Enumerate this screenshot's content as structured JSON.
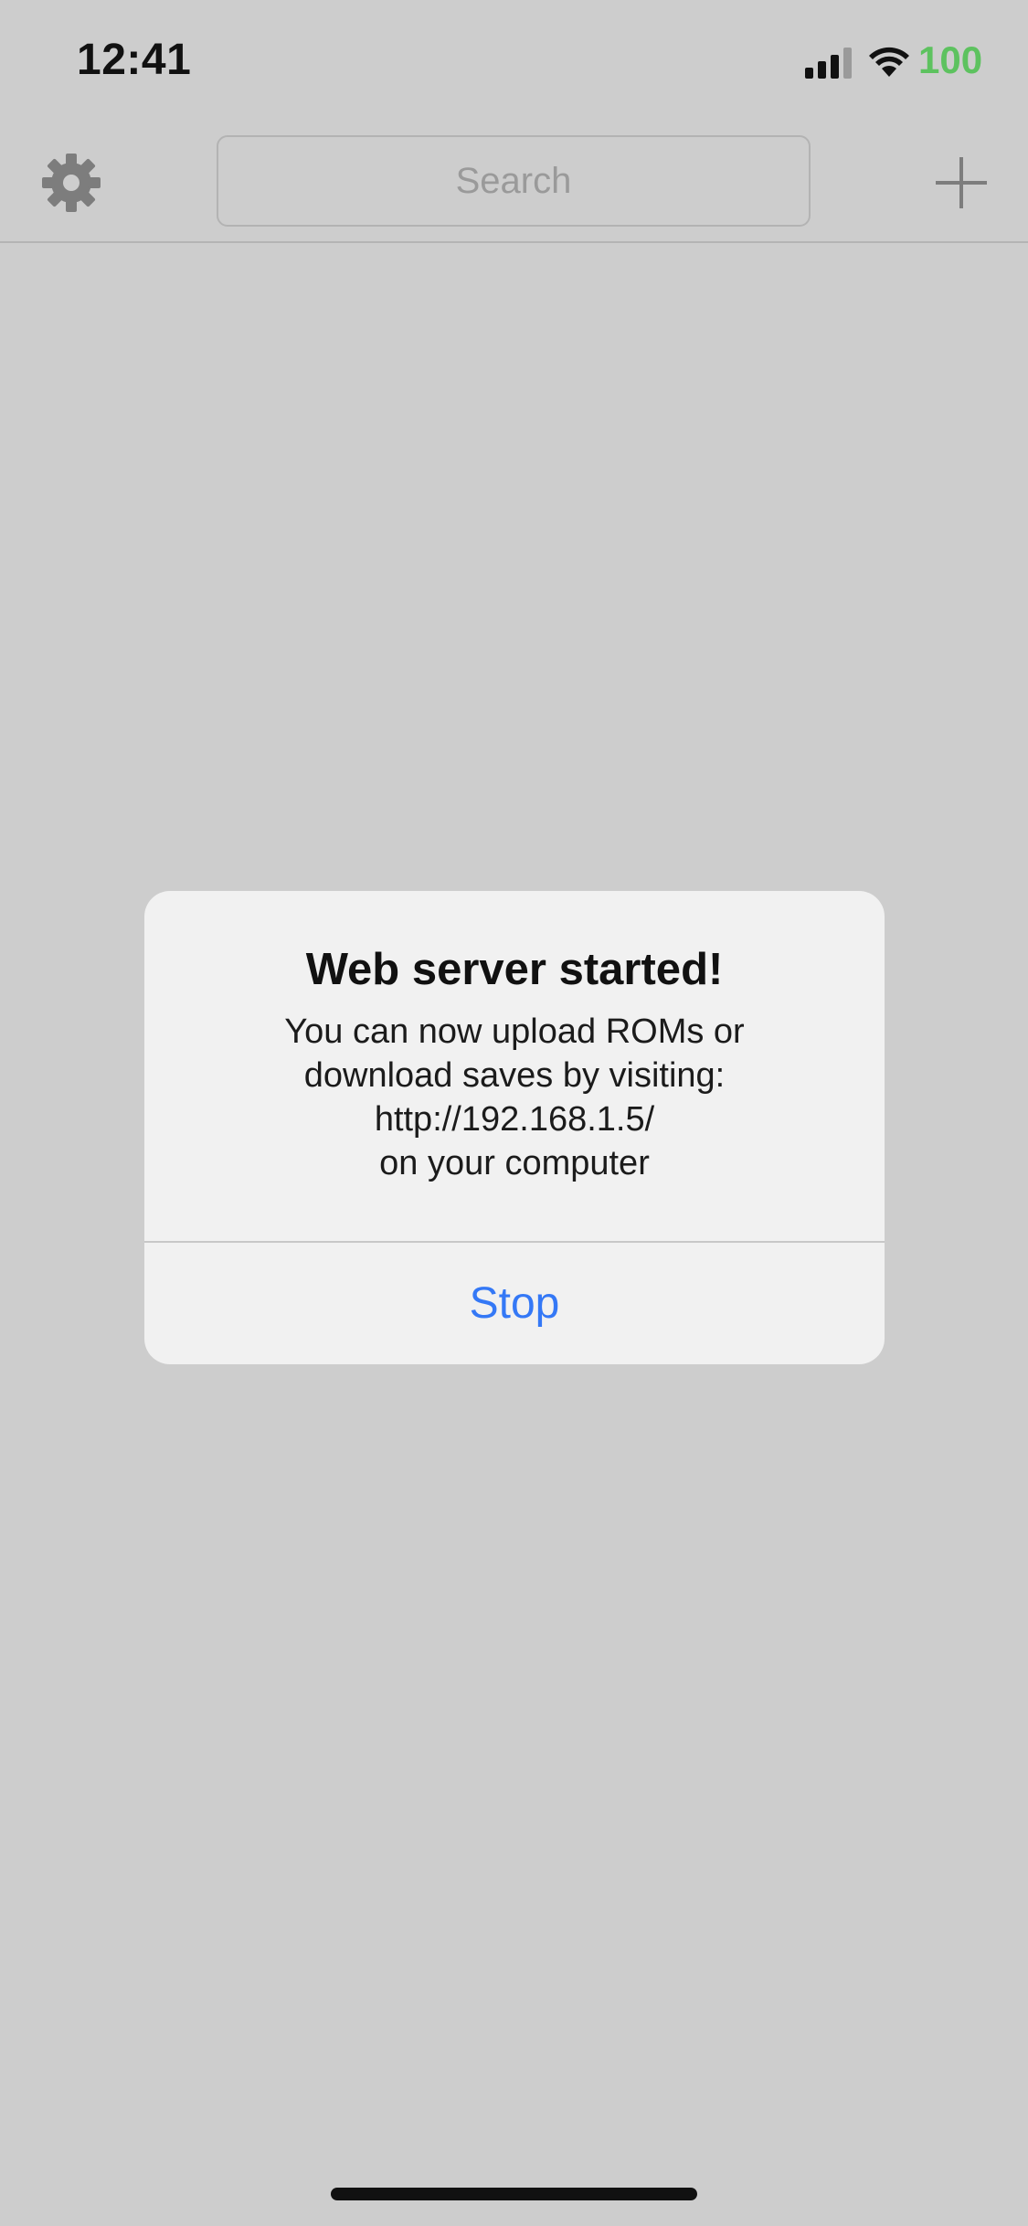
{
  "status_bar": {
    "time": "12:41",
    "battery_level": "100",
    "signal_icon": "cellular-signal-icon",
    "wifi_icon": "wifi-icon",
    "battery_color": "#5dc25f"
  },
  "nav_bar": {
    "settings_icon": "gear-icon",
    "search_placeholder": "Search",
    "add_icon": "plus-icon"
  },
  "alert": {
    "title": "Web server started!",
    "message_lines": [
      "You can now upload ROMs or",
      "download saves by visiting:",
      "http://192.168.1.5/",
      "on your computer"
    ],
    "button_label": "Stop",
    "button_color": "#3478f6"
  }
}
